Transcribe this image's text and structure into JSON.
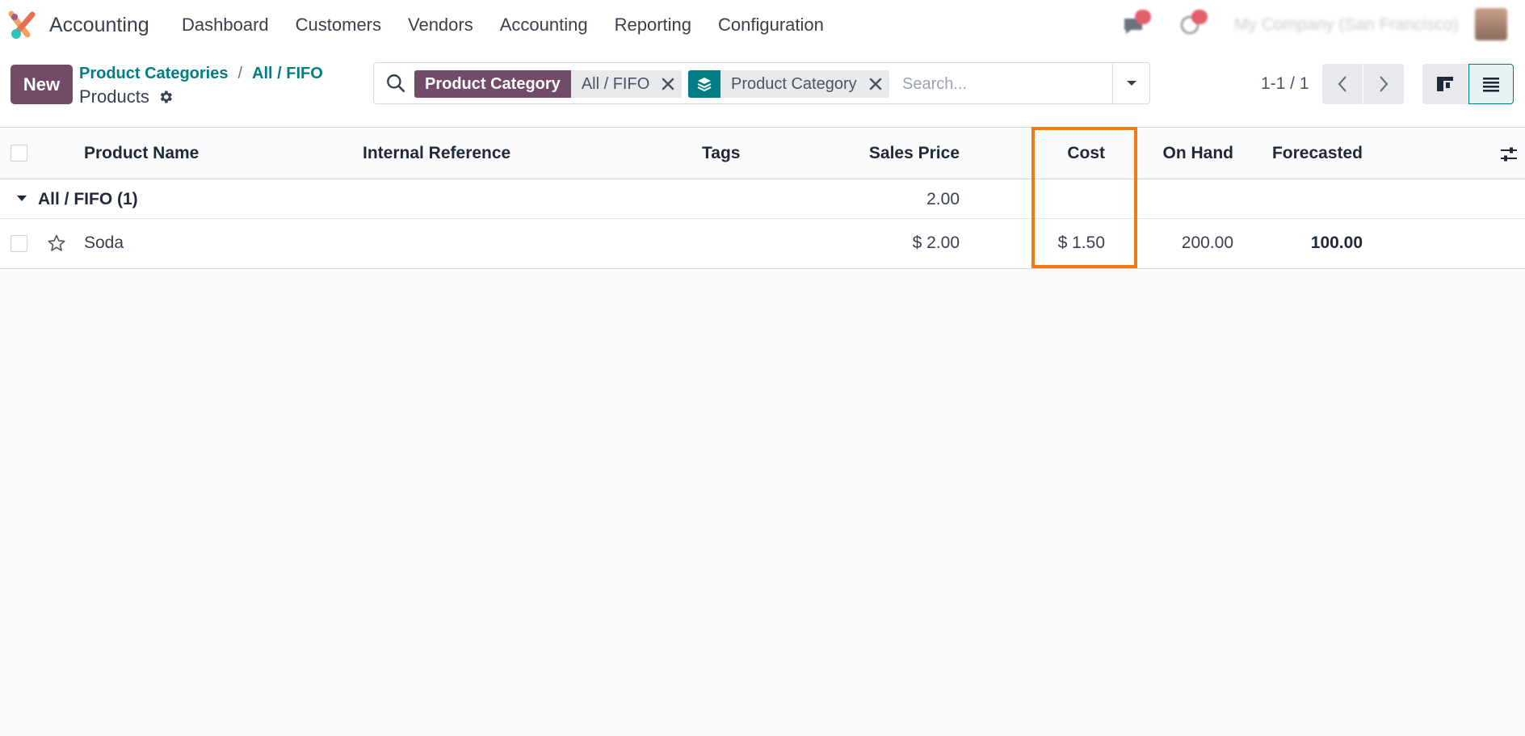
{
  "app": {
    "name": "Accounting"
  },
  "menu": [
    "Dashboard",
    "Customers",
    "Vendors",
    "Accounting",
    "Reporting",
    "Configuration"
  ],
  "header": {
    "company": "My Company (San Francisco)"
  },
  "control": {
    "new_label": "New",
    "breadcrumb": [
      "Product Categories",
      "All / FIFO"
    ],
    "breadcrumb_sep": "/",
    "title": "Products"
  },
  "search": {
    "facet1_label": "Product Category",
    "facet1_value": "All / FIFO",
    "facet2_value": "Product Category",
    "placeholder": "Search..."
  },
  "pager": {
    "value": "1-1 / 1"
  },
  "table": {
    "columns": {
      "name": "Product Name",
      "ref": "Internal Reference",
      "tags": "Tags",
      "price": "Sales Price",
      "cost": "Cost",
      "onhand": "On Hand",
      "forecast": "Forecasted"
    },
    "group": {
      "label": "All / FIFO (1)",
      "price_total": "2.00"
    },
    "rows": [
      {
        "name": "Soda",
        "price": "$ 2.00",
        "cost": "$ 1.50",
        "onhand": "200.00",
        "forecast": "100.00"
      }
    ]
  },
  "colors": {
    "primary": "#714b67",
    "teal": "#017e84",
    "highlight": "#ef7a1a"
  }
}
